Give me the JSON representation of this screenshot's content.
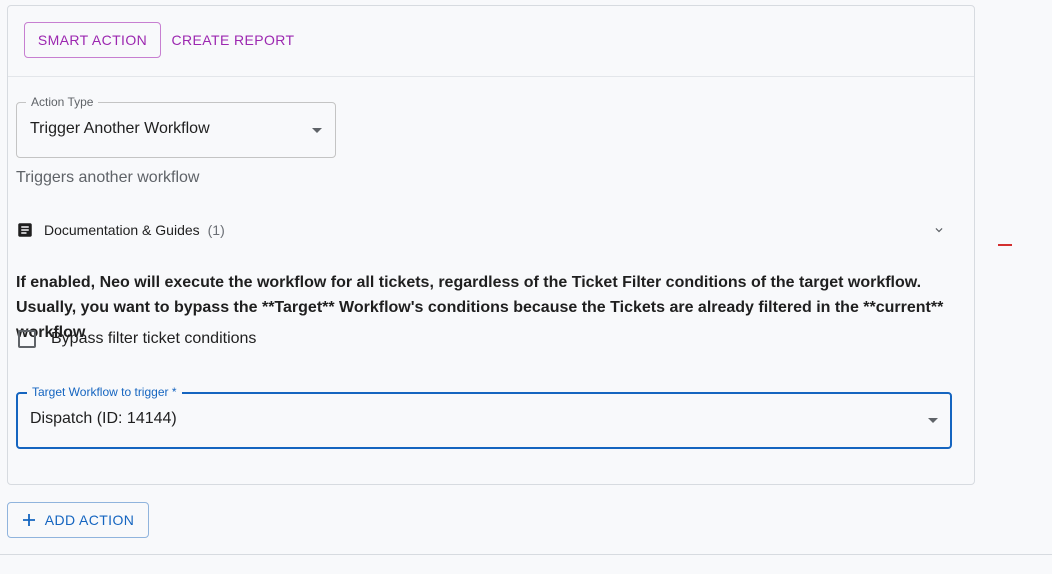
{
  "tabs": {
    "smart_action": "SMART ACTION",
    "create_report": "CREATE REPORT"
  },
  "action_type": {
    "legend": "Action Type",
    "value": "Trigger Another Workflow",
    "helper": "Triggers another workflow"
  },
  "documentation": {
    "label": "Documentation & Guides",
    "count": "(1)"
  },
  "description": "If enabled, Neo will execute the workflow for all tickets, regardless of the Ticket Filter conditions of the target workflow. Usually, you want to bypass the **Target** Workflow's conditions because the Tickets are already filtered in the **current** workflow",
  "bypass": {
    "label": "Bypass filter ticket conditions",
    "checked": false
  },
  "target_workflow": {
    "legend": "Target Workflow to trigger *",
    "value": "Dispatch (ID: 14144)"
  },
  "add_action": {
    "label": "ADD ACTION"
  },
  "colors": {
    "accent_purple": "#9c27b0",
    "accent_blue": "#1565c0",
    "error_red": "#d32f2f"
  },
  "icons": {
    "documentation": "article-icon",
    "expand": "chevron-down-icon",
    "add": "plus-icon",
    "select": "caret-down-icon"
  }
}
